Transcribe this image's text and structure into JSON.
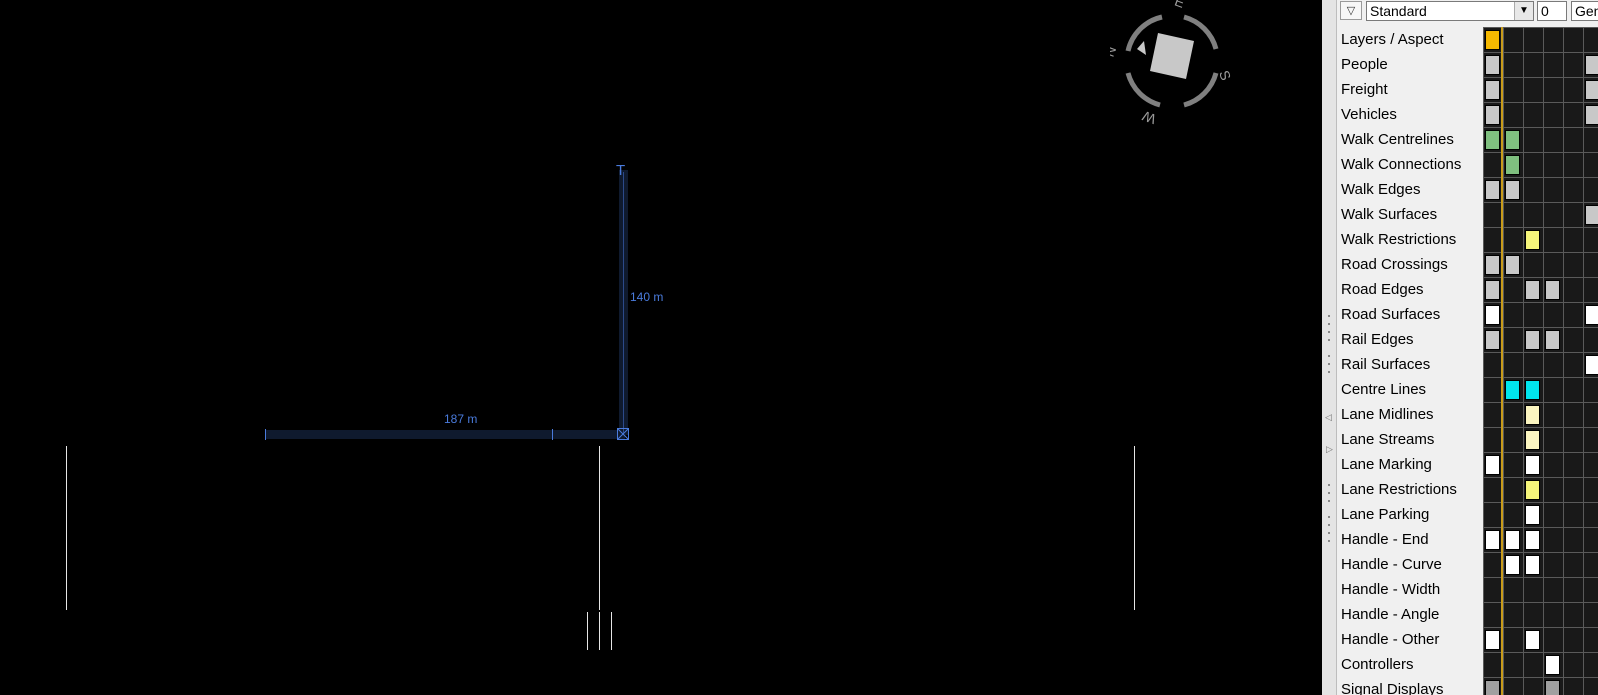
{
  "viewport": {
    "scale_bar": {
      "horizontal_label": "187 m",
      "vertical_label": "140 m",
      "top_marker": "T"
    },
    "compass": {
      "labels": [
        "E",
        "S",
        "W",
        "N"
      ],
      "ring_color": "#808080",
      "square_color": "#c8c8c8"
    },
    "scale_color": "#4a7bdc"
  },
  "panel": {
    "filter_icon": "filter-icon",
    "aspect_value": "Standard",
    "number_value": "0",
    "general_value": "General",
    "layers": [
      "Layers / Aspect",
      "People",
      "Freight",
      "Vehicles",
      "Walk Centrelines",
      "Walk Connections",
      "Walk Edges",
      "Walk Surfaces",
      "Walk Restrictions",
      "Road Crossings",
      "Road Edges",
      "Road Surfaces",
      "Rail Edges",
      "Rail Surfaces",
      "Centre Lines",
      "Lane Midlines",
      "Lane Streams",
      "Lane Marking",
      "Lane Restrictions",
      "Lane Parking",
      "Handle - End",
      "Handle - Curve",
      "Handle - Width",
      "Handle - Angle",
      "Handle - Other",
      "Controllers",
      "Signal Displays"
    ],
    "cell_colors": {
      "gold": "#f5b800",
      "grey": "#c8c8c8",
      "green": "#7fbf7f",
      "yellow": "#f5f57a",
      "cyan": "#00e5ee",
      "cream": "#fbf5c0",
      "white": "#ffffff",
      "midgrey": "#a0a0a0"
    }
  }
}
